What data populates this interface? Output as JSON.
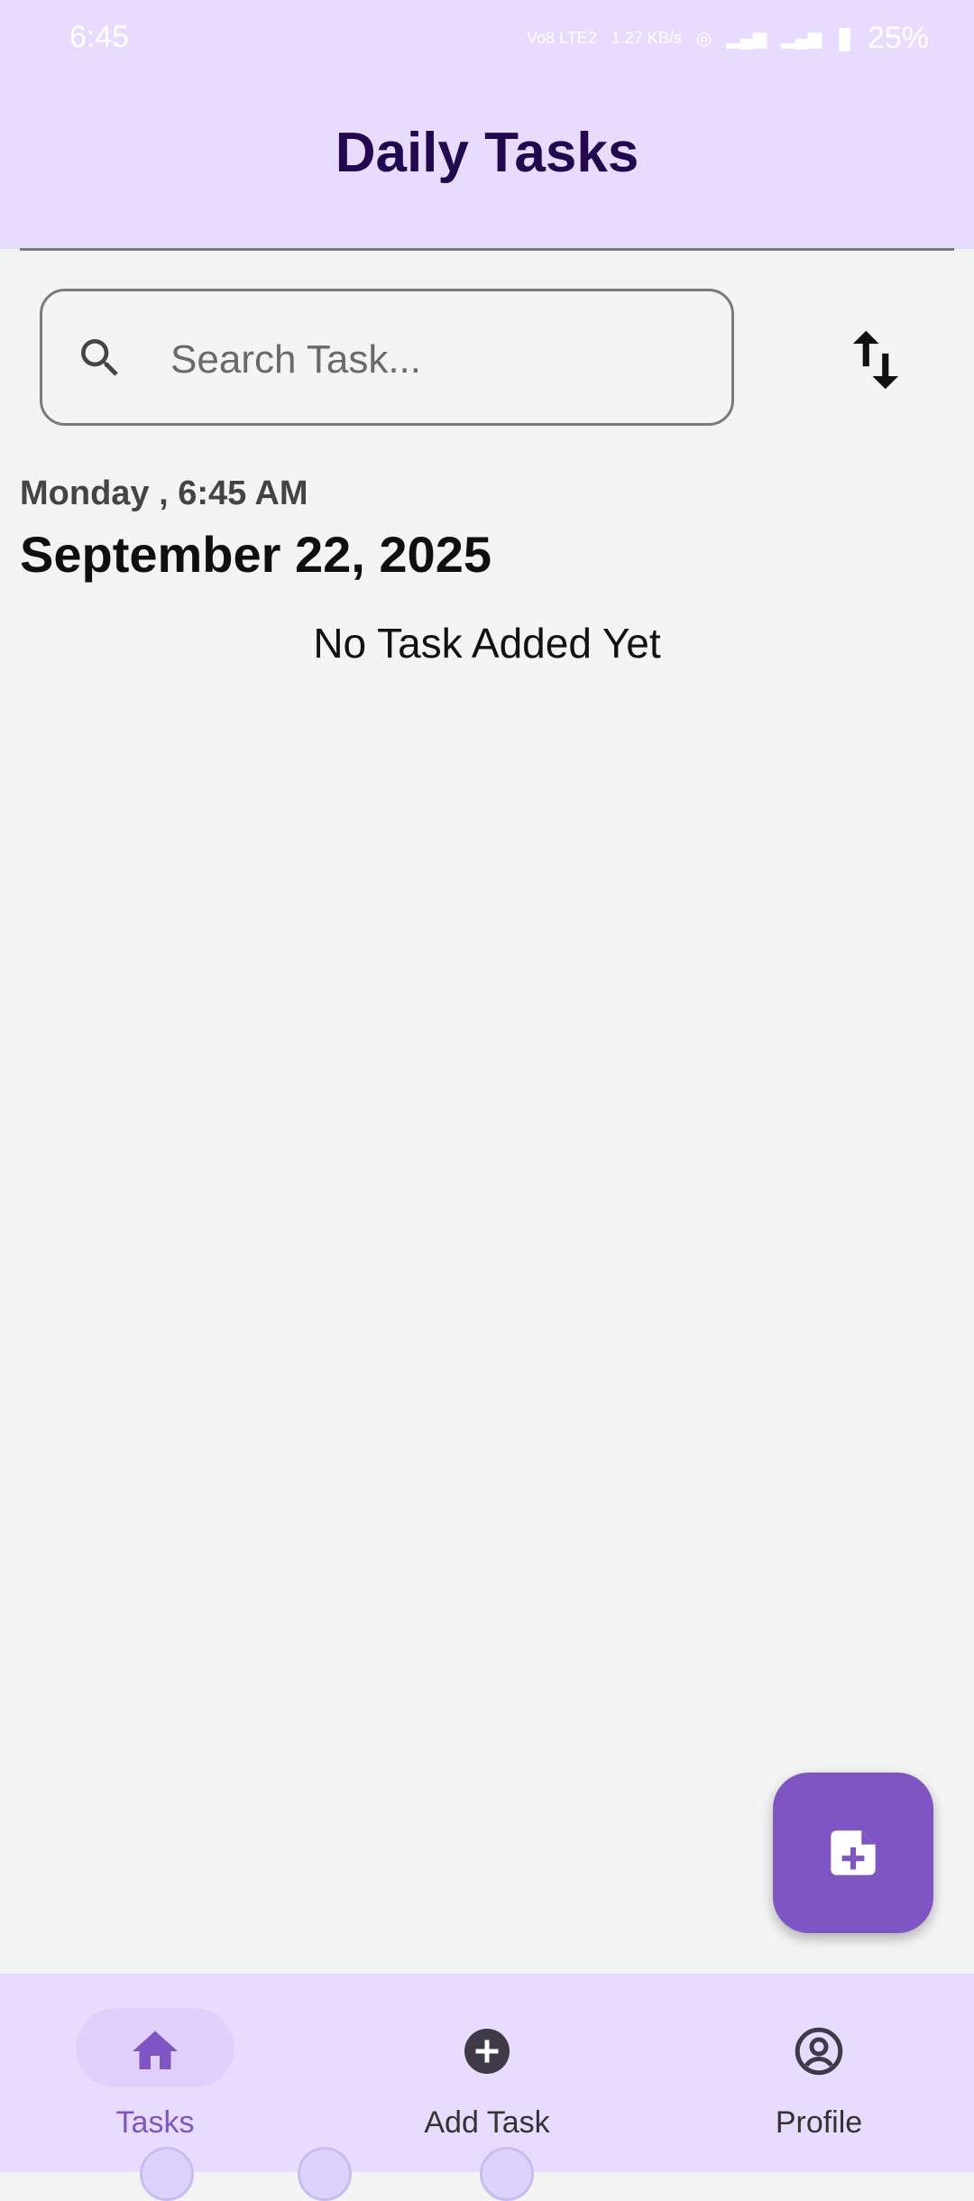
{
  "status_bar": {
    "time": "6:45",
    "network": "Vo8 LTE2",
    "speed": "1.27 KB/s",
    "battery": "25%"
  },
  "app_bar": {
    "title": "Daily Tasks"
  },
  "search": {
    "placeholder": "Search Task..."
  },
  "date": {
    "day_time": "Monday , 6:45 AM",
    "full_date": "September 22, 2025"
  },
  "empty_state": "No Task Added Yet",
  "bottom_nav": {
    "items": [
      {
        "label": "Tasks",
        "icon": "home-icon",
        "selected": true
      },
      {
        "label": "Add Task",
        "icon": "add-circle-icon",
        "selected": false
      },
      {
        "label": "Profile",
        "icon": "account-circle-icon",
        "selected": false
      }
    ]
  },
  "colors": {
    "accent": "#7f55c3",
    "bar_background": "#e8dcfe",
    "title": "#22094f"
  }
}
